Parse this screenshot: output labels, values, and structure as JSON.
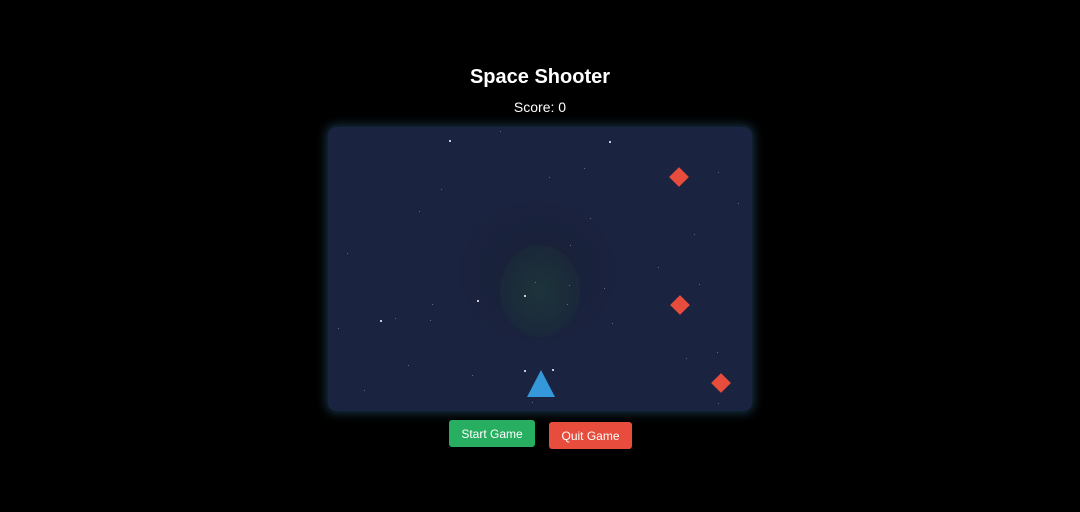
{
  "game": {
    "title": "Space Shooter",
    "score_label": "Score:",
    "score_value": "0"
  },
  "buttons": {
    "start_label": "Start Game",
    "quit_label": "Quit Game"
  },
  "colors": {
    "background": "#000000",
    "arena": "#1a2340",
    "player": "#3498db",
    "enemy": "#e74c3c",
    "start_button": "#27ae60",
    "quit_button": "#e74c3c"
  },
  "entities": {
    "player_shape": "triangle",
    "enemy_shape": "diamond",
    "enemy_count": 3
  }
}
